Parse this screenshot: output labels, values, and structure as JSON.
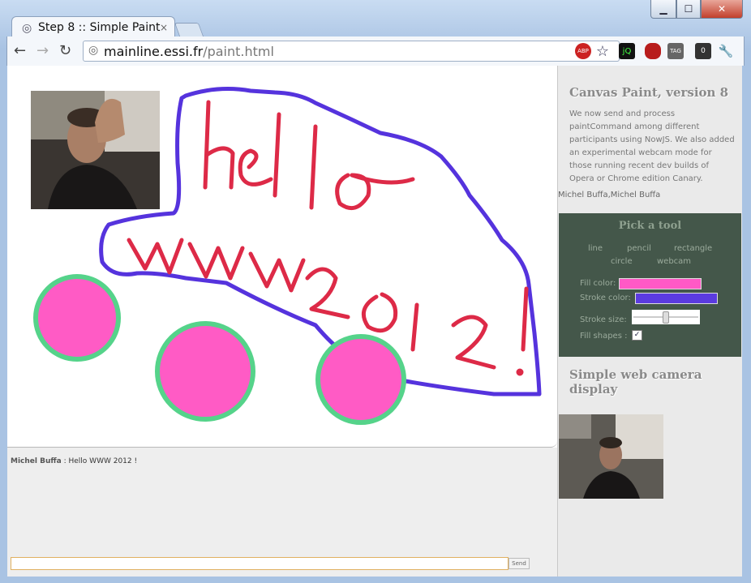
{
  "window": {
    "tab_title": "Step 8 :: Simple Paint",
    "tab_close": "×",
    "url_host": "mainline.essi.fr",
    "url_path": "/paint.html",
    "controls": {
      "min": "▁",
      "max": "☐",
      "close": "✕"
    },
    "extensions": [
      "ABP",
      "☆",
      "jQ",
      "",
      "TAG",
      "0",
      "🔧"
    ]
  },
  "chat": {
    "author": "Michel Buffa",
    "message": " : Hello WWW 2012 !",
    "input_value": "",
    "send_label": "Send"
  },
  "sidebar": {
    "title": "Canvas Paint, version 8",
    "description": "We now send and process paintCommand among different participants using NowJS. We also added an experimental webcam mode for those running recent dev builds of Opera or Chrome edition Canary.",
    "participants": "Michel Buffa,Michel Buffa",
    "tools_title": "Pick a tool",
    "tools": [
      "line",
      "pencil",
      "rectangle",
      "circle",
      "webcam"
    ],
    "fill_label": "Fill color:",
    "fill_color": "#ff59c6",
    "stroke_label": "Stroke color:",
    "stroke_color": "#5b3be0",
    "stroke_size_label": "Stroke size:",
    "stroke_size_fraction": 0.5,
    "fill_shapes_label": "Fill shapes :",
    "fill_shapes_checked": "✓",
    "camera_title": "Simple web camera display"
  },
  "canvas_drawing": {
    "text_color": "#dd2a47",
    "outline_color": "#5533dd",
    "wheel_fill": "#ff5bc5",
    "wheel_stroke": "#55d38a"
  }
}
